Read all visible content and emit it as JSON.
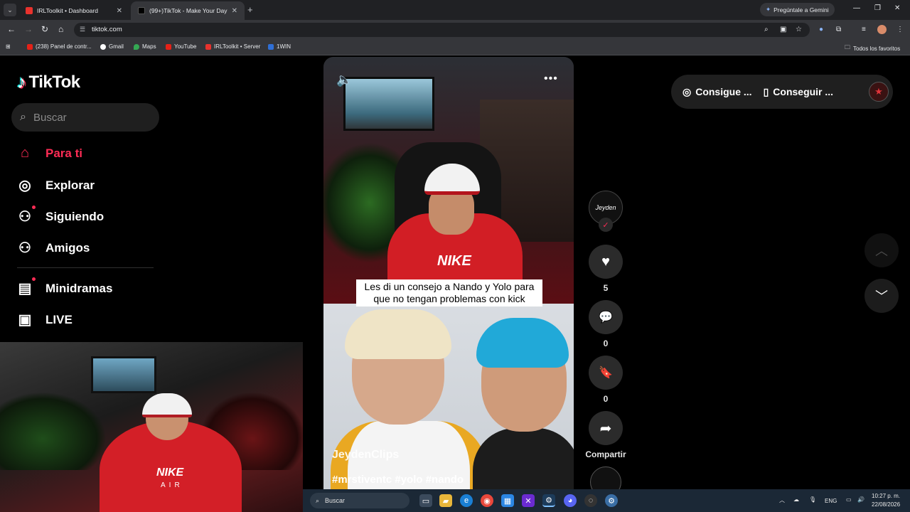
{
  "browser": {
    "tabs": [
      {
        "title": "IRLToolkit • Dashboard",
        "active": false
      },
      {
        "title": "(99+)TikTok - Make Your Day",
        "active": true
      }
    ],
    "gemini_label": "Pregúntale a Gemini",
    "url": "tiktok.com",
    "bookmarks": [
      "(238) Panel de contr...",
      "Gmail",
      "Maps",
      "YouTube",
      "IRLToolkit • Server",
      "1WIN"
    ],
    "all_bookmarks": "Todos los favoritos"
  },
  "tiktok": {
    "logo": "TikTok",
    "search_placeholder": "Buscar",
    "nav": [
      {
        "label": "Para ti",
        "icon": "home-icon",
        "active": true
      },
      {
        "label": "Explorar",
        "icon": "compass-icon"
      },
      {
        "label": "Siguiendo",
        "icon": "following-icon"
      },
      {
        "label": "Amigos",
        "icon": "friends-icon"
      },
      {
        "label": "Minidramas",
        "icon": "film-icon"
      },
      {
        "label": "LIVE",
        "icon": "live-icon"
      }
    ],
    "video": {
      "caption": "Les di un consejo a Nando y Yolo para que no tengan problemas con kick",
      "author": "JeydenClips",
      "hashtags": "#mrstiventc #yolo #nando",
      "webcam_shirt": "NIKE",
      "webcam_shirt_sub": "AIR"
    },
    "actions": {
      "avatar_text": "Jeyden",
      "likes": "5",
      "comments": "0",
      "saves": "0",
      "share_label": "Compartir"
    },
    "header": {
      "get_coins": "Consigue ...",
      "get_app": "Conseguir ..."
    }
  },
  "taskbar": {
    "search_placeholder": "Buscar",
    "lang": "ENG",
    "time": "10:27 p. m.",
    "date": "22/08/2026"
  }
}
